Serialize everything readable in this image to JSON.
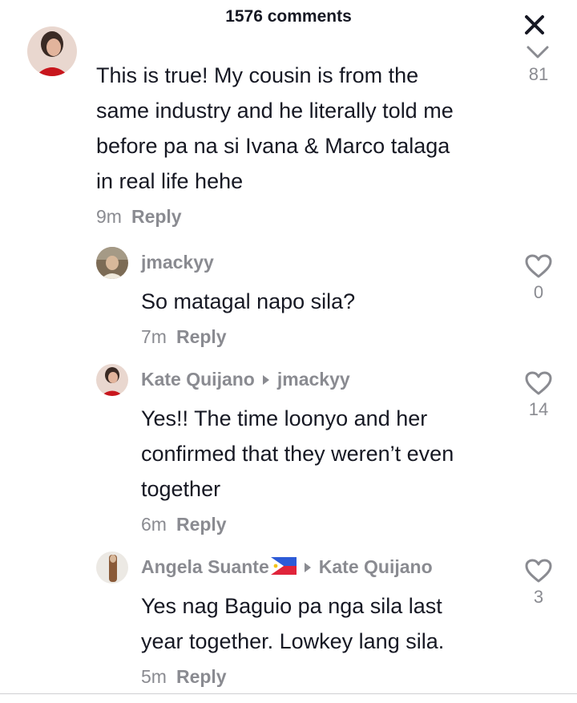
{
  "header": {
    "comment_count": "1576 comments"
  },
  "top_comment": {
    "lines": [
      "This is true! My cousin is from the",
      "same industry and he literally told me",
      "before pa na si Ivana & Marco talaga",
      "in real life hehe"
    ],
    "time": "9m",
    "reply_label": "Reply",
    "likes": "81"
  },
  "replies": [
    {
      "username": "jmackyy",
      "reply_to": "",
      "lines": [
        "So matagal napo sila?"
      ],
      "time": "7m",
      "reply_label": "Reply",
      "likes": "0"
    },
    {
      "username": "Kate Quijano",
      "reply_to": "jmackyy",
      "lines": [
        "Yes!! The time loonyo and her",
        "confirmed that they weren’t even",
        "together"
      ],
      "time": "6m",
      "reply_label": "Reply",
      "likes": "14"
    },
    {
      "username": "Angela Suante",
      "reply_to": "Kate Quijano",
      "lines": [
        "Yes nag Baguio pa nga sila last",
        "year together. Lowkey lang sila."
      ],
      "time": "5m",
      "reply_label": "Reply",
      "likes": "3"
    }
  ],
  "colors": {
    "text": "#161823",
    "muted": "#8a8b91",
    "background": "#ffffff"
  },
  "icons": [
    "close-icon",
    "chevron-down-icon",
    "heart-outline-icon",
    "philippines-flag-icon"
  ]
}
